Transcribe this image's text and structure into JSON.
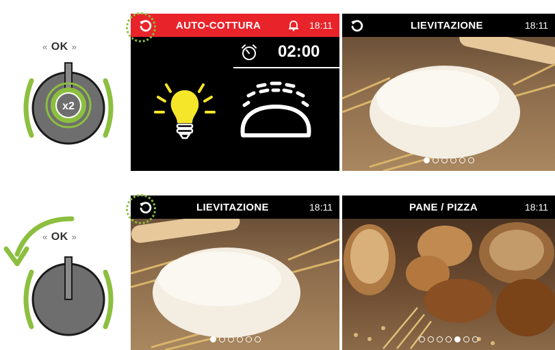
{
  "knob_top": {
    "ok_text": "OK",
    "press_badge": "x2"
  },
  "knob_bottom": {
    "ok_text": "OK"
  },
  "screen_auto": {
    "title": "AUTO-COTTURA",
    "time": "18:11",
    "timer": "02:00",
    "bar_color": "#e8232a"
  },
  "screen_lievitazione_1": {
    "title": "LIEVITAZIONE",
    "time": "18:11",
    "dots_total": 6,
    "dots_active_index": 0
  },
  "screen_lievitazione_2": {
    "title": "LIEVITAZIONE",
    "time": "18:11",
    "dots_total": 6,
    "dots_active_index": 0
  },
  "screen_pane": {
    "title": "PANE / PIZZA",
    "time": "18:11",
    "dots_total": 7,
    "dots_active_index": 4
  },
  "colors": {
    "accent_green": "#8cbf3f",
    "lamp_yellow": "#f6e62a"
  }
}
